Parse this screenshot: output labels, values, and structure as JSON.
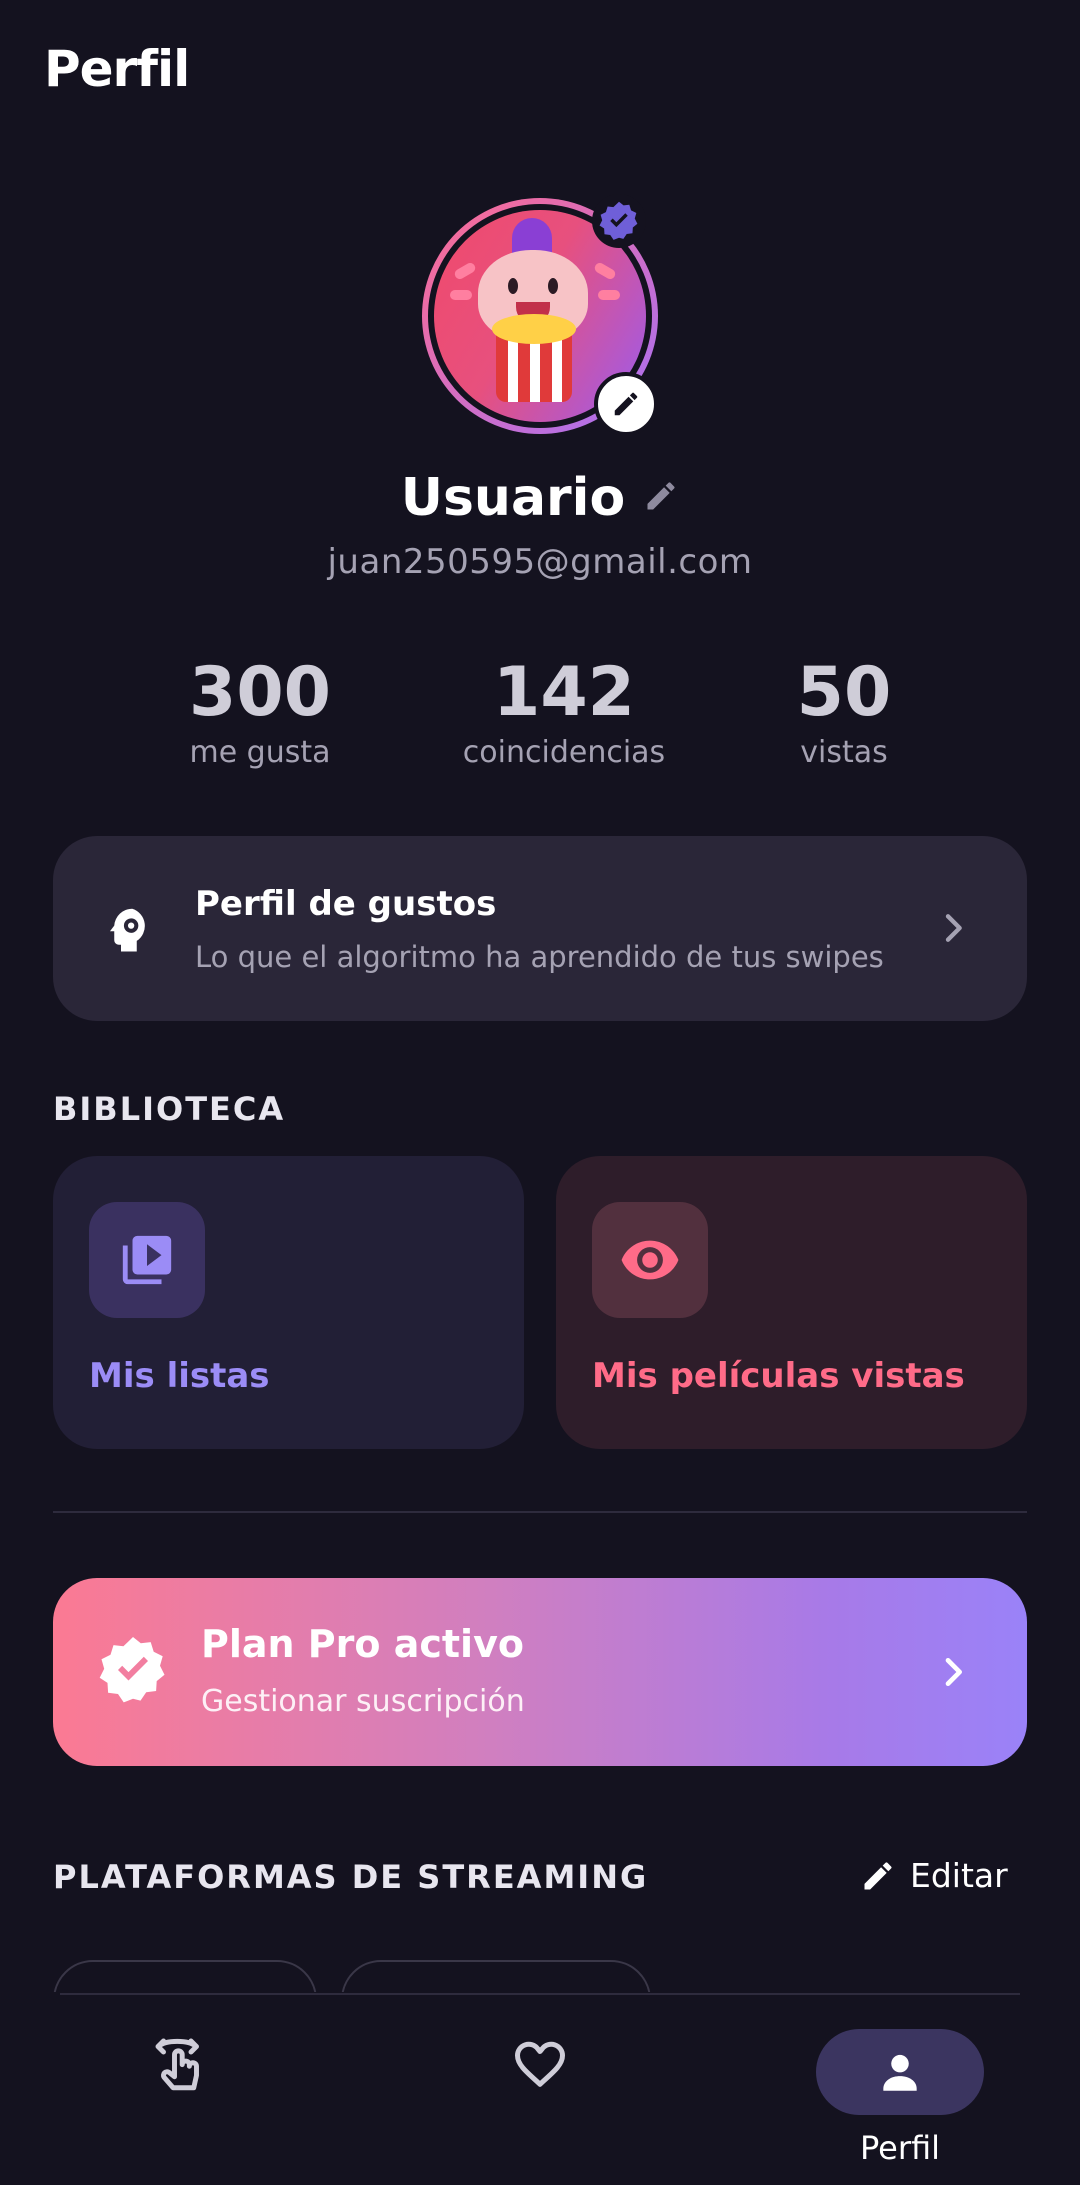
{
  "header": {
    "title": "Perfil"
  },
  "profile": {
    "username": "Usuario",
    "email": "juan250595@gmail.com"
  },
  "stats": [
    {
      "value": "300",
      "label": "me gusta"
    },
    {
      "value": "142",
      "label": "coincidencias"
    },
    {
      "value": "50",
      "label": "vistas"
    }
  ],
  "taste_profile": {
    "title": "Perfil de gustos",
    "subtitle": "Lo que el algoritmo ha aprendido de tus swipes"
  },
  "library": {
    "section_label": "BIBLIOTECA",
    "cards": [
      {
        "label": "Mis listas",
        "icon": "video-library-icon"
      },
      {
        "label": "Mis películas vistas",
        "icon": "eye-icon"
      }
    ]
  },
  "plan": {
    "title": "Plan Pro activo",
    "subtitle": "Gestionar suscripción"
  },
  "platforms": {
    "section_label": "PLATAFORMAS DE STREAMING",
    "edit_label": "Editar"
  },
  "bottom_nav": {
    "items": [
      {
        "icon": "swipe-icon",
        "label": ""
      },
      {
        "icon": "heart-icon",
        "label": ""
      },
      {
        "icon": "person-icon",
        "label": "Perfil",
        "active": true
      }
    ]
  },
  "colors": {
    "background": "#14121f",
    "card": "#2a2638",
    "accent_purple": "#9b8cf6",
    "accent_pink": "#ff6b88",
    "muted_text": "#a5a2b3"
  }
}
